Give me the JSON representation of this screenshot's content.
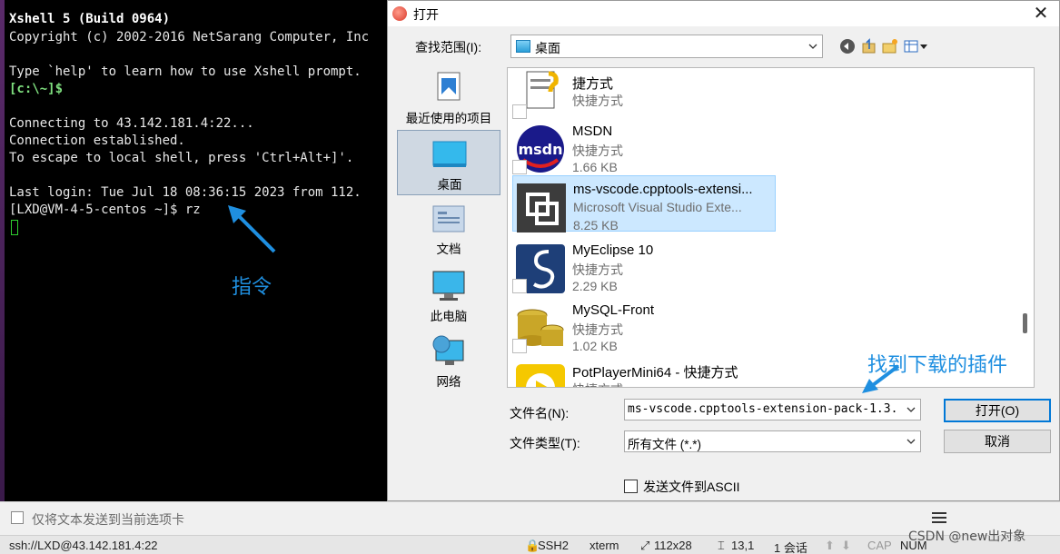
{
  "terminal": {
    "lines": [
      {
        "text": "Xshell 5 (Build 0964)",
        "style": "bold"
      },
      {
        "text": "Copyright (c) 2002-2016 NetSarang Computer, Inc",
        "style": "normal"
      },
      {
        "text": "",
        "style": "normal"
      },
      {
        "text": "Type `help' to learn how to use Xshell prompt.",
        "style": "normal"
      },
      {
        "text": "[c:\\~]$",
        "style": "green"
      },
      {
        "text": "",
        "style": "normal"
      },
      {
        "text": "Connecting to 43.142.181.4:22...",
        "style": "normal"
      },
      {
        "text": "Connection established.",
        "style": "normal"
      },
      {
        "text": "To escape to local shell, press 'Ctrl+Alt+]'.",
        "style": "normal"
      },
      {
        "text": "",
        "style": "normal"
      },
      {
        "text": "Last login: Tue Jul 18 08:36:15 2023 from 112.",
        "style": "normal"
      },
      {
        "text": "[LXD@VM-4-5-centos ~]$ rz",
        "style": "normal"
      }
    ],
    "annotation": "指令"
  },
  "sendbar": {
    "text": "仅将文本发送到当前选项卡"
  },
  "statusbar": {
    "connection": "ssh://LXD@43.142.181.4:22",
    "protocol": "SSH2",
    "terminal_type": "xterm",
    "size": "112x28",
    "cursor_pos": "13,1",
    "sessions": "1 会话",
    "caps": "CAP",
    "num": "NUM"
  },
  "watermark": "CSDN @new出对象",
  "dialog": {
    "title": "打开",
    "close_glyph": "✕",
    "lookin_label": "查找范围(I):",
    "lookin_value": "桌面",
    "places": [
      {
        "label": "最近使用的项目",
        "icon": "recent-items-icon"
      },
      {
        "label": "桌面",
        "icon": "desktop-icon"
      },
      {
        "label": "文档",
        "icon": "documents-icon"
      },
      {
        "label": "此电脑",
        "icon": "computer-icon"
      },
      {
        "label": "网络",
        "icon": "network-icon"
      }
    ],
    "files": [
      {
        "name": "捷方式",
        "type": "快捷方式",
        "size": ""
      },
      {
        "name": "MSDN",
        "type": "快捷方式",
        "size": "1.66 KB"
      },
      {
        "name": "ms-vscode.cpptools-extensi...",
        "type": "Microsoft Visual Studio Exte...",
        "size": "8.25 KB"
      },
      {
        "name": "MyEclipse 10",
        "type": "快捷方式",
        "size": "2.29 KB"
      },
      {
        "name": "MySQL-Front",
        "type": "快捷方式",
        "size": "1.02 KB"
      },
      {
        "name": "PotPlayerMini64 - 快捷方式",
        "type": "快捷方式",
        "size": ""
      }
    ],
    "find_annotation": "找到下载的插件",
    "filename_label": "文件名(N):",
    "filename_value": "ms-vscode.cpptools-extension-pack-1.3.",
    "filetype_label": "文件类型(T):",
    "filetype_value": "所有文件 (*.*)",
    "open_button": "打开(O)",
    "cancel_button": "取消",
    "ascii_checkbox": "发送文件到ASCII"
  }
}
